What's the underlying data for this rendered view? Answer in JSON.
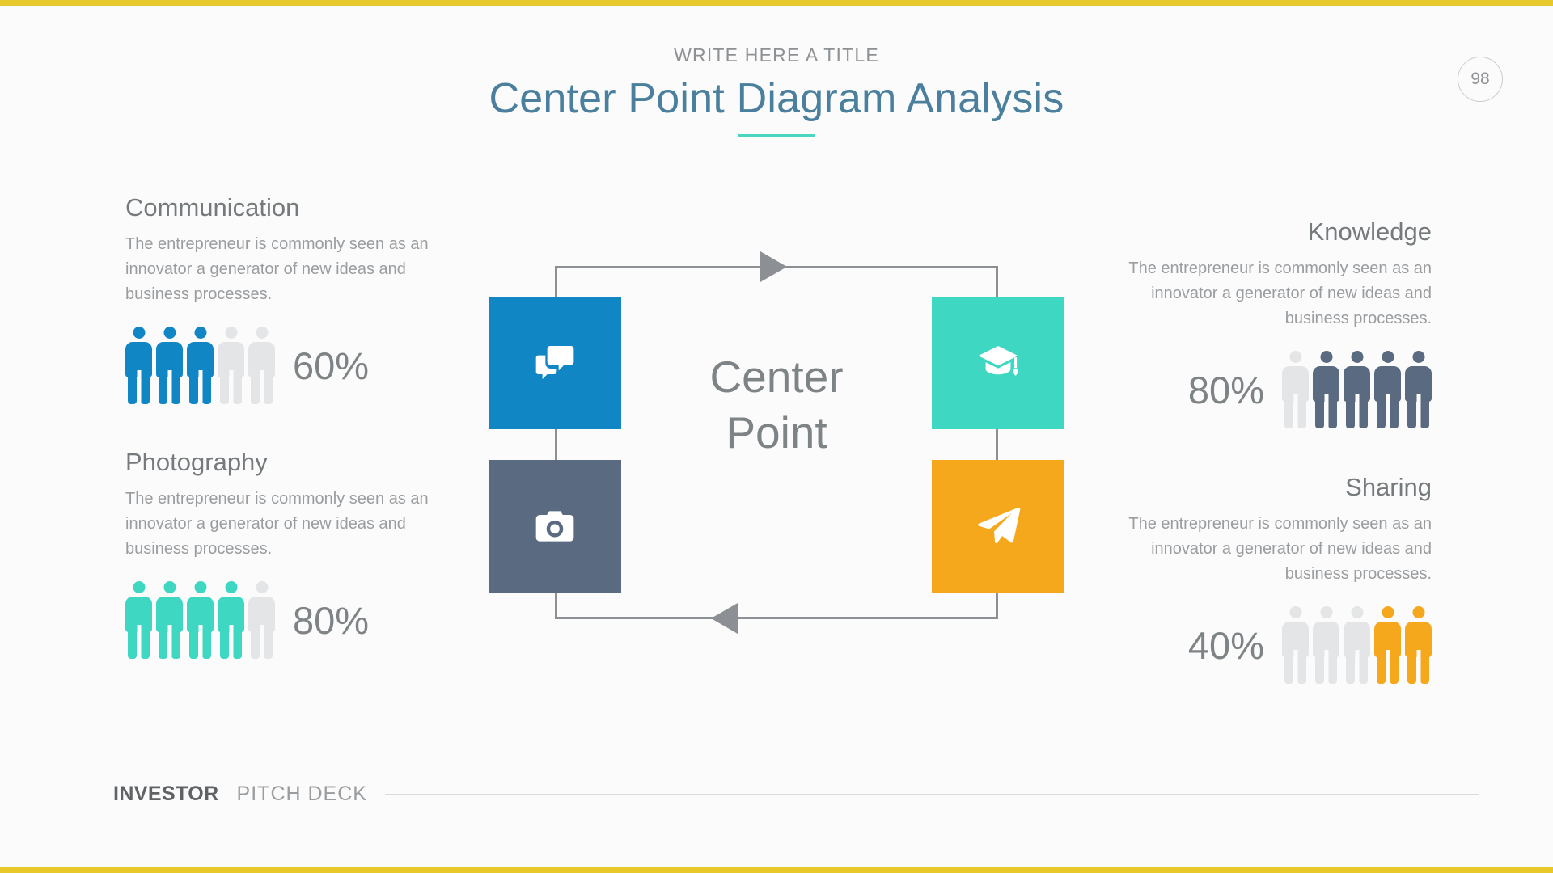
{
  "header": {
    "kicker": "WRITE HERE A TITLE",
    "title": "Center Point Diagram Analysis",
    "page_number": "98"
  },
  "center": {
    "line1": "Center",
    "line2": "Point"
  },
  "panels": {
    "communication": {
      "title": "Communication",
      "body": "The entrepreneur is commonly seen as an innovator a generator of new ideas and business processes.",
      "percent": "60%",
      "icon": "chat-bubbles-icon",
      "color": "#1186c4",
      "filled": 3,
      "total": 5
    },
    "photography": {
      "title": "Photography",
      "body": "The entrepreneur is commonly seen as an innovator a generator of new ideas and business processes.",
      "percent": "80%",
      "icon": "camera-icon",
      "color": "#3ed7c2",
      "square_color": "#5a6a80",
      "filled": 4,
      "total": 5
    },
    "knowledge": {
      "title": "Knowledge",
      "body": "The entrepreneur is commonly seen as an innovator a generator of new ideas and business processes.",
      "percent": "80%",
      "icon": "graduation-cap-icon",
      "color": "#5a6a80",
      "square_color": "#3ed7c2",
      "filled": 4,
      "total": 5
    },
    "sharing": {
      "title": "Sharing",
      "body": "The entrepreneur is commonly seen as an innovator a generator of new ideas and business processes.",
      "percent": "40%",
      "icon": "paper-plane-icon",
      "color": "#f5a81c",
      "filled": 2,
      "total": 5
    }
  },
  "colors": {
    "blue": "#1186c4",
    "teal": "#3ed7c2",
    "slate": "#5a6a80",
    "orange": "#f5a81c",
    "grey_person": "#e3e5e6",
    "title_blue": "#4a7f9e",
    "accent_rule": "#4ad6c0",
    "border_yellow": "#e8c92c"
  },
  "footer": {
    "bold": "INVESTOR",
    "light": "PITCH DECK"
  }
}
